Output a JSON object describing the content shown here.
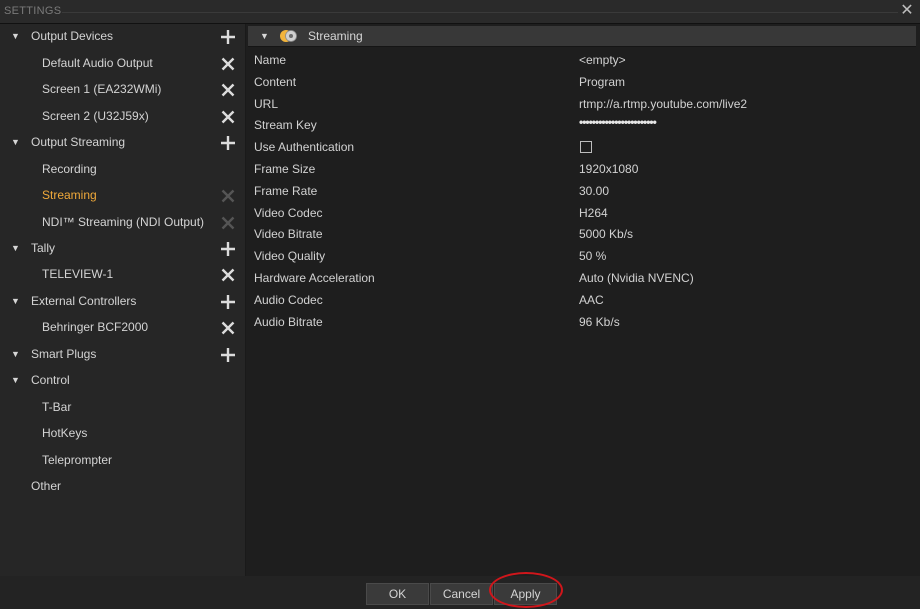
{
  "window": {
    "title": "SETTINGS"
  },
  "sidebar": {
    "items": [
      {
        "label": "Output Devices",
        "kind": "cat",
        "action": "plus"
      },
      {
        "label": "Default Audio Output",
        "kind": "child",
        "action": "x"
      },
      {
        "label": "Screen 1 (EA232WMi)",
        "kind": "child",
        "action": "x"
      },
      {
        "label": "Screen 2 (U32J59x)",
        "kind": "child",
        "action": "x"
      },
      {
        "label": "Output Streaming",
        "kind": "cat",
        "action": "plus"
      },
      {
        "label": "Recording",
        "kind": "child",
        "action": "none"
      },
      {
        "label": "Streaming",
        "kind": "child",
        "action": "x-dim",
        "selected": true
      },
      {
        "label": "NDI™ Streaming (NDI Output)",
        "kind": "child",
        "action": "x-dim"
      },
      {
        "label": "Tally",
        "kind": "cat",
        "action": "plus"
      },
      {
        "label": "TELEVIEW-1",
        "kind": "child",
        "action": "x"
      },
      {
        "label": "External Controllers",
        "kind": "cat",
        "action": "plus"
      },
      {
        "label": "Behringer BCF2000",
        "kind": "child",
        "action": "x"
      },
      {
        "label": "Smart Plugs",
        "kind": "cat",
        "action": "plus"
      },
      {
        "label": "Control",
        "kind": "cat",
        "action": "none"
      },
      {
        "label": "T-Bar",
        "kind": "child",
        "action": "none"
      },
      {
        "label": "HotKeys",
        "kind": "child",
        "action": "none"
      },
      {
        "label": "Teleprompter",
        "kind": "child",
        "action": "none"
      },
      {
        "label": "Other",
        "kind": "root",
        "action": "none"
      }
    ]
  },
  "section": {
    "title": "Streaming"
  },
  "properties": [
    {
      "key": "Name",
      "value": "<empty>"
    },
    {
      "key": "Content",
      "value": "Program"
    },
    {
      "key": "URL",
      "value": "rtmp://a.rtmp.youtube.com/live2"
    },
    {
      "key": "Stream Key",
      "value": "••••••••••••••••••••••••",
      "masked": true
    },
    {
      "key": "Use Authentication",
      "value": "",
      "checkbox": true,
      "checked": false
    },
    {
      "key": "Frame Size",
      "value": "1920x1080"
    },
    {
      "key": "Frame Rate",
      "value": "30.00"
    },
    {
      "key": "Video Codec",
      "value": "H264"
    },
    {
      "key": "Video Bitrate",
      "value": "5000 Kb/s"
    },
    {
      "key": "Video Quality",
      "value": "50 %"
    },
    {
      "key": "Hardware Acceleration",
      "value": "Auto (Nvidia NVENC)"
    },
    {
      "key": "Audio Codec",
      "value": "AAC"
    },
    {
      "key": "Audio Bitrate",
      "value": "96 Kb/s"
    }
  ],
  "footer": {
    "ok_label": "OK",
    "cancel_label": "Cancel",
    "apply_label": "Apply"
  },
  "colors": {
    "accent": "#f0a93a",
    "highlight": "#d0161b"
  }
}
